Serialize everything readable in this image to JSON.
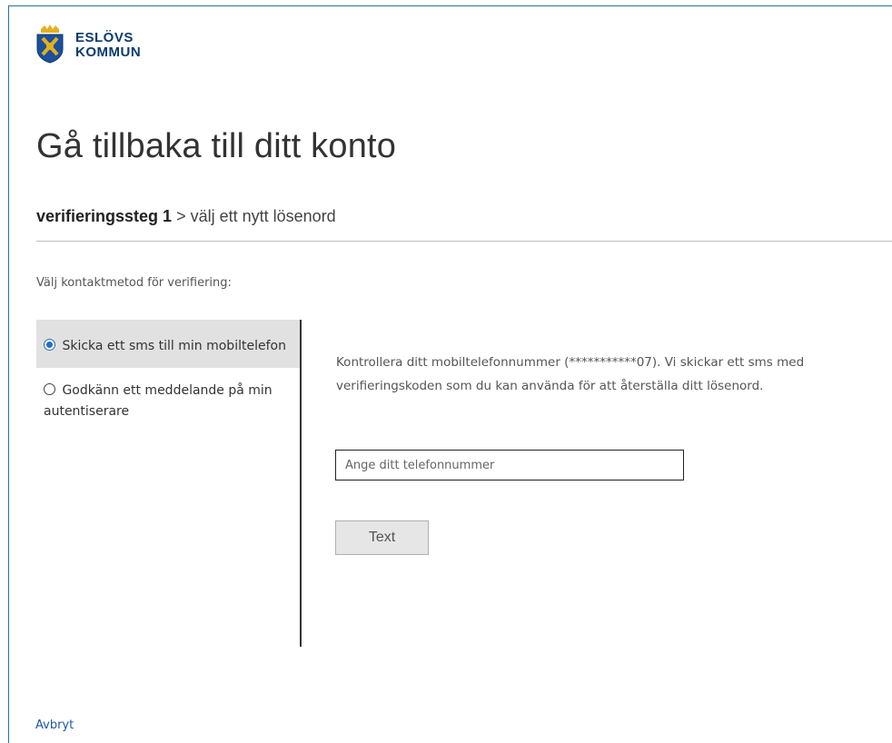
{
  "brand": {
    "logo_line1": "ESLÖVS",
    "logo_line2": "KOMMUN",
    "logo_icon": "municipal-coat-of-arms",
    "color": "#0b3a6f"
  },
  "page": {
    "title": "Gå tillbaka till ditt konto",
    "breadcrumb": {
      "current_step": "verifieringssteg 1",
      "separator": ">",
      "next_step": "välj ett nytt lösenord"
    },
    "instruction": "Välj kontaktmetod för verifiering:"
  },
  "methods": [
    {
      "label": "Skicka ett sms till min mobiltelefon",
      "selected": true
    },
    {
      "label": "Godkänn ett meddelande på min autentiserare",
      "selected": false
    }
  ],
  "verification": {
    "description": "Kontrollera ditt mobiltelefonnummer (***********07). Vi skickar ett sms med verifieringskoden som du kan använda för att återställa ditt lösenord.",
    "phone_placeholder": "Ange ditt telefonnummer",
    "phone_value": "",
    "submit_label": "Text"
  },
  "footer": {
    "cancel_label": "Avbryt"
  },
  "colors": {
    "accent": "#1f6fcf",
    "link": "#1a56a6",
    "selected_bg": "#e1e1e1"
  }
}
